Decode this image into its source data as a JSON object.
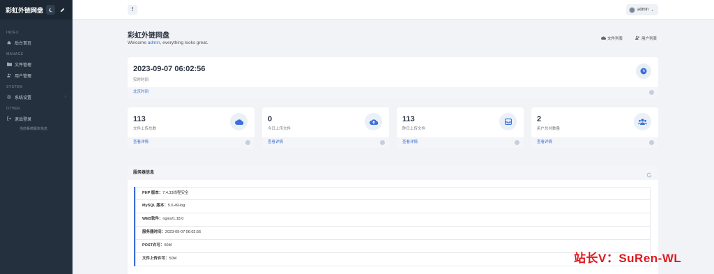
{
  "sidebar": {
    "title": "彩虹外链网盘",
    "sections": [
      {
        "label": "INDEX",
        "items": [
          {
            "label": "后台首页",
            "icon": "home-icon"
          }
        ]
      },
      {
        "label": "MANAGE",
        "items": [
          {
            "label": "文件管理",
            "icon": "folder-icon"
          },
          {
            "label": "用户管理",
            "icon": "users-icon"
          }
        ]
      },
      {
        "label": "SYSTEM",
        "items": [
          {
            "label": "系统设置",
            "icon": "gear-icon"
          }
        ]
      },
      {
        "label": "OTHER",
        "items": [
          {
            "label": "退出登录",
            "icon": "logout-icon"
          }
        ]
      }
    ],
    "note": "当前系统版本信息"
  },
  "topbar": {
    "user": "admin"
  },
  "header": {
    "title": "彩虹外链网盘",
    "welcome_prefix": "Welcome ",
    "welcome_user": "admin",
    "welcome_suffix": ", everything looks great.",
    "links": [
      "文件列表",
      "用户列表"
    ]
  },
  "time_card": {
    "value": "2023-09-07 06:02:56",
    "label": "实时时间",
    "footer": "北京时间"
  },
  "stats": [
    {
      "value": "113",
      "label": "文件上传总数",
      "footer": "查看详情",
      "icon": "cloud-icon"
    },
    {
      "value": "0",
      "label": "今日上传文件",
      "footer": "查看详情",
      "icon": "cloud-upload-icon"
    },
    {
      "value": "113",
      "label": "昨日上传文件",
      "footer": "查看详情",
      "icon": "inbox-icon"
    },
    {
      "value": "2",
      "label": "用户总共数量",
      "footer": "查看详情",
      "icon": "users-icon"
    }
  ],
  "server_info": {
    "title": "服务器信息",
    "rows": [
      {
        "key": "PHP 版本：",
        "value": "7.4.33线程安全"
      },
      {
        "key": "MySQL 版本：",
        "value": "5.6.49-log"
      },
      {
        "key": "WEB软件：",
        "value": "nginx/1.18.0"
      },
      {
        "key": "服务器时间：",
        "value": "2023-09-07 06:02:56"
      },
      {
        "key": "POST许可：",
        "value": "50M"
      },
      {
        "key": "文件上传许可：",
        "value": "50M"
      }
    ]
  },
  "watermark": "站长V：SuRen-WL",
  "colors": {
    "sidebar": "#24303e",
    "accent": "#3c6fd8",
    "watermark": "#e0191f"
  }
}
